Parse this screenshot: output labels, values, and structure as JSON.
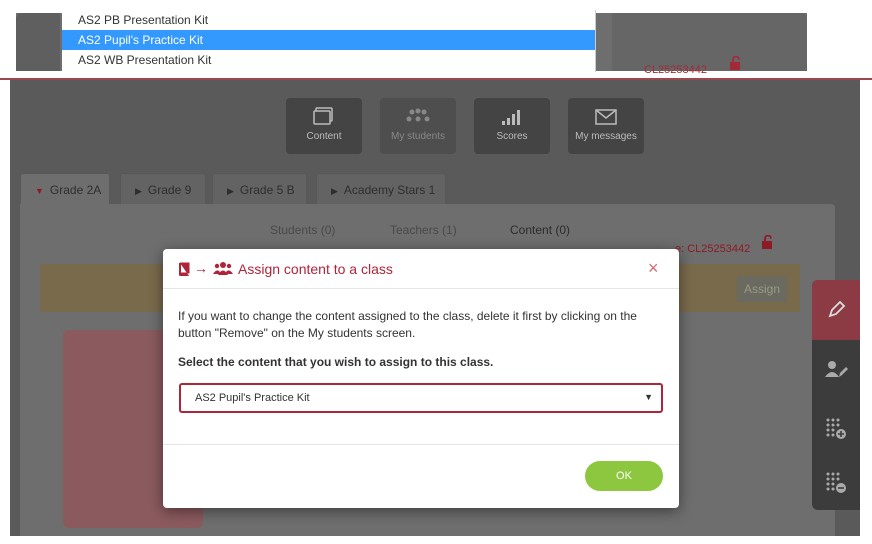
{
  "dropdown": {
    "options": [
      {
        "label": "AS2 PB Presentation Kit",
        "selected": false
      },
      {
        "label": "AS2 Pupil's Practice Kit",
        "selected": true
      },
      {
        "label": "AS2 WB Presentation Kit",
        "selected": false
      }
    ]
  },
  "top_class_code": "CL25253442",
  "nav": {
    "items": [
      {
        "label": "Content",
        "icon": "content-icon"
      },
      {
        "label": "My students",
        "icon": "students-icon"
      },
      {
        "label": "Scores",
        "icon": "scores-icon"
      },
      {
        "label": "My messages",
        "icon": "envelope-icon"
      }
    ]
  },
  "class_tabs": [
    {
      "label": "Grade 2A",
      "active": true
    },
    {
      "label": "Grade 9",
      "active": false
    },
    {
      "label": "Grade 5 B",
      "active": false
    },
    {
      "label": "Academy Stars 1",
      "active": false
    }
  ],
  "sub_tabs": [
    {
      "label": "Students (0)",
      "active": false
    },
    {
      "label": "Teachers (1)",
      "active": false
    },
    {
      "label": "Content (0)",
      "active": true
    }
  ],
  "class_code_text": "e: CL25253442",
  "assign_label": "Assign",
  "toolbar": {
    "items": [
      "pencil-icon",
      "edit-user-icon",
      "add-grid-icon",
      "remove-grid-icon"
    ]
  },
  "modal": {
    "title": "Assign content to a class",
    "close": "×",
    "arrow": "→",
    "info": "If you want to change the content assigned to the class, delete it first by clicking on the button \"Remove\" on the My students screen.",
    "prompt": "Select the content that you wish to assign to this class.",
    "selected_value": "AS2 Pupil's Practice Kit",
    "caret": "▼",
    "ok_label": "OK"
  },
  "colors": {
    "accent": "#b0243a",
    "ok_green": "#8dc63f",
    "highlight_blue": "#3399ff"
  }
}
